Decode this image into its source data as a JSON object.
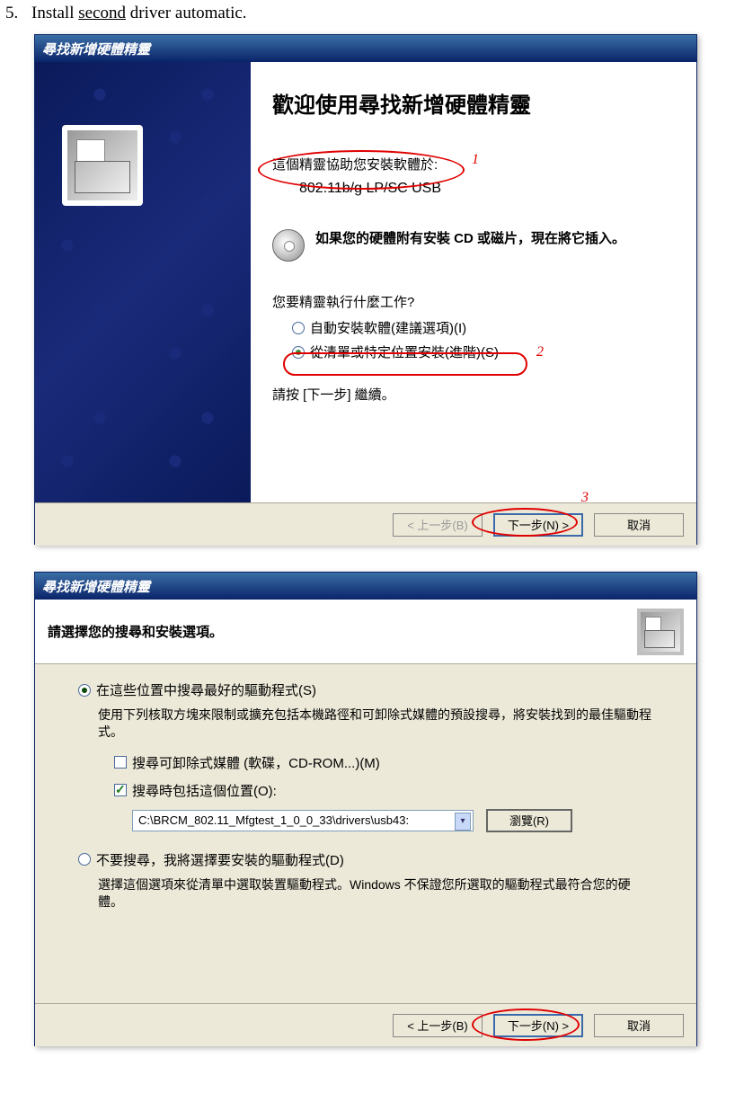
{
  "doc": {
    "step_num": "5.",
    "step_text_pre": "Install ",
    "step_text_underlined": "second",
    "step_text_post": " driver automatic."
  },
  "wizard1": {
    "title": "尋找新增硬體精靈",
    "welcome": "歡迎使用尋找新增硬體精靈",
    "help_text": "這個精靈協助您安裝軟體於:",
    "device": "802.11b/g LP/SC USB",
    "cd_prompt": "如果您的硬體附有安裝 CD 或磁片，現在將它插入。",
    "question": "您要精靈執行什麼工作?",
    "radio_auto": "自動安裝軟體(建議選項)(I)",
    "radio_list": "從清單或特定位置安裝(進階)(S)",
    "continue": "請按 [下一步] 繼續。",
    "selected_option": "list",
    "anno": {
      "n1": "1",
      "n2": "2",
      "n3": "3"
    }
  },
  "wizard2": {
    "title": "尋找新增硬體精靈",
    "header": "請選擇您的搜尋和安裝選項。",
    "radio_search": "在這些位置中搜尋最好的驅動程式(S)",
    "search_desc": "使用下列核取方塊來限制或擴充包括本機路徑和可卸除式媒體的預設搜尋，將安裝找到的最佳驅動程式。",
    "chk_removable": "搜尋可卸除式媒體 (軟碟，CD-ROM...)(M)",
    "chk_removable_checked": false,
    "chk_include": "搜尋時包括這個位置(O):",
    "chk_include_checked": true,
    "path": "C:\\BRCM_802.11_Mfgtest_1_0_0_33\\drivers\\usb43:",
    "radio_nosearch": "不要搜尋，我將選擇要安裝的驅動程式(D)",
    "nosearch_desc": "選擇這個選項來從清單中選取裝置驅動程式。Windows 不保證您所選取的驅動程式最符合您的硬體。",
    "selected_option": "search"
  },
  "buttons": {
    "back": "< 上一步(B)",
    "next": "下一步(N) >",
    "cancel": "取消",
    "browse": "瀏覽(R)"
  }
}
